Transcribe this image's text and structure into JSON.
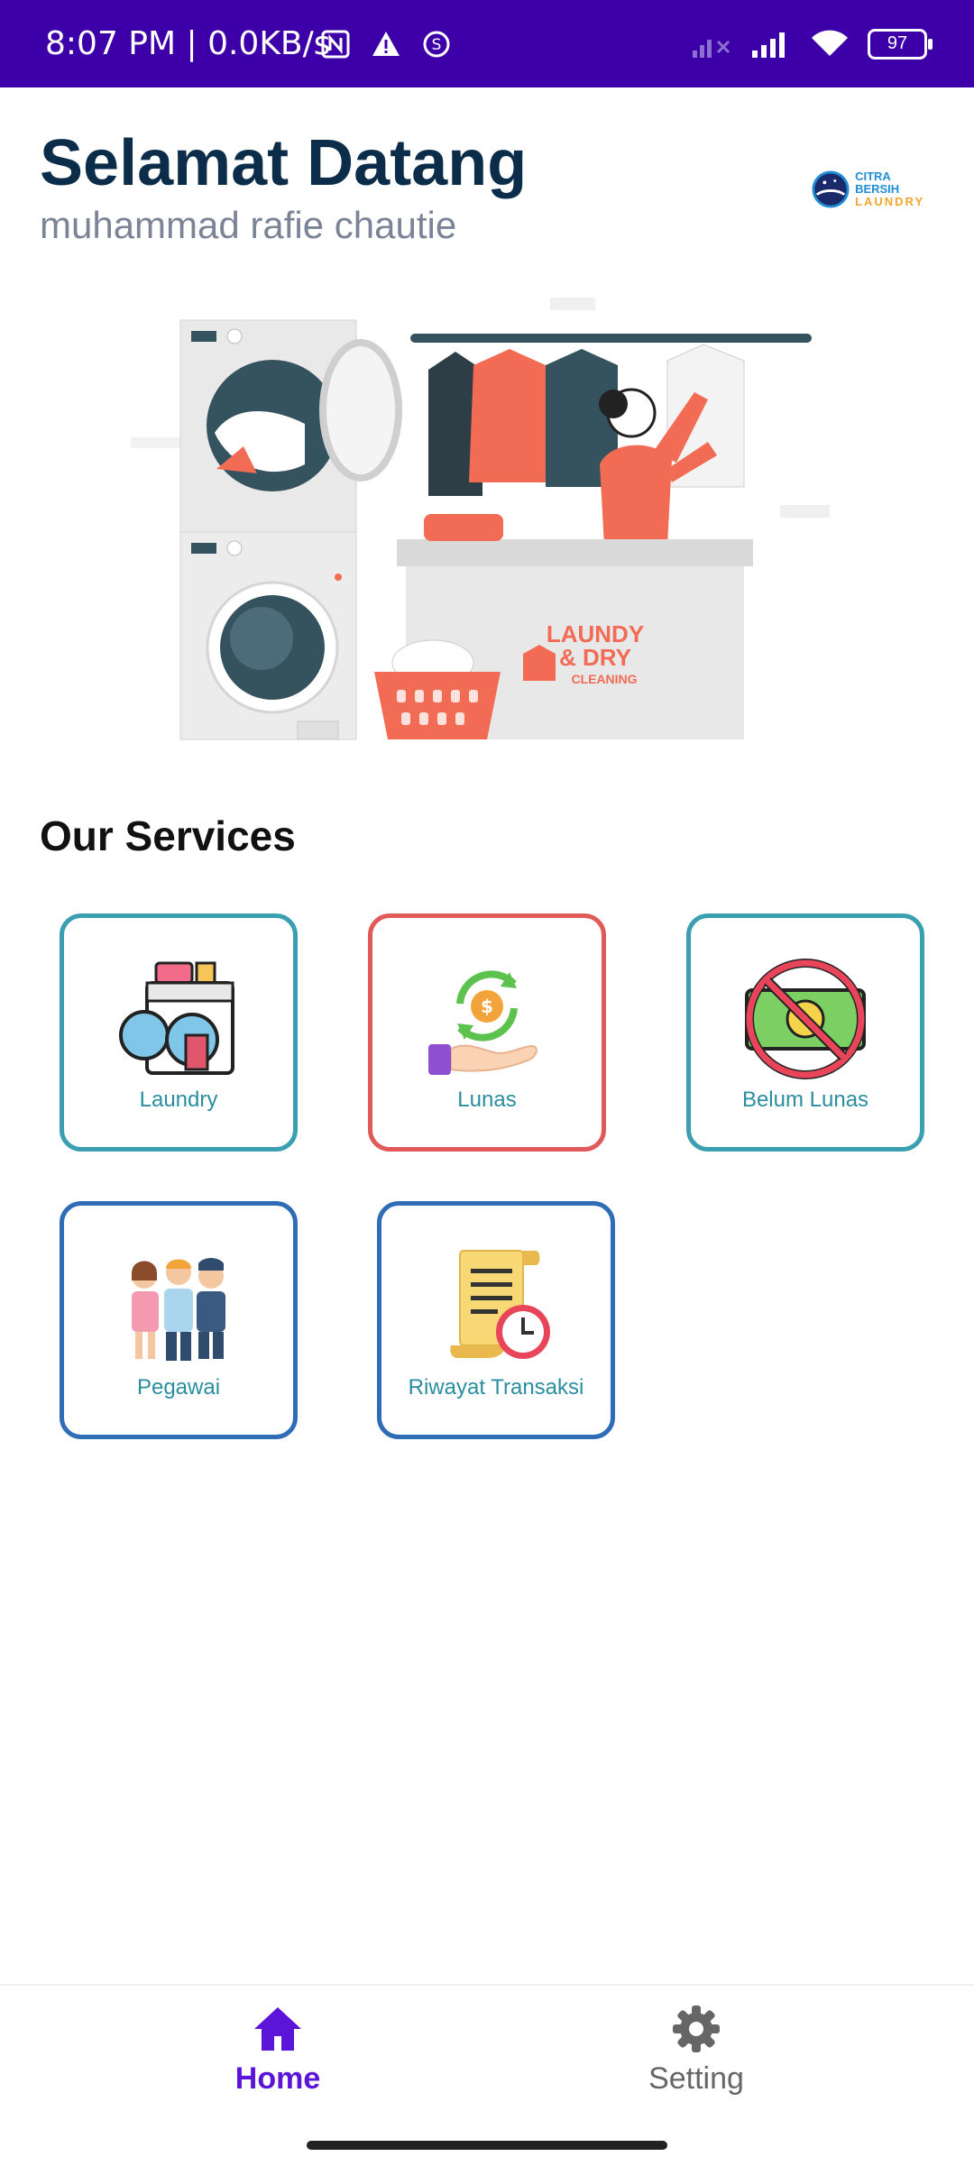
{
  "status_bar": {
    "time_speed": "8:07 PM | 0.0KB/s",
    "battery": "97",
    "icons": [
      "nfc-icon",
      "warning-icon",
      "sync-icon",
      "signal-off-icon",
      "signal-icon",
      "wifi-icon",
      "battery-icon"
    ]
  },
  "header": {
    "title": "Selamat Datang",
    "user_name": "muhammad rafie chautie",
    "logo_line1": "CITRA BERSIH",
    "logo_line2": "LAUNDRY"
  },
  "hero": {
    "sign_line1": "LAUNDY",
    "sign_line2": "& DRY",
    "sign_line3": "CLEANING"
  },
  "services": {
    "title": "Our Services",
    "items": [
      {
        "label": "Laundry",
        "icon": "washing-machine-icon"
      },
      {
        "label": "Lunas",
        "icon": "money-hand-icon"
      },
      {
        "label": "Belum Lunas",
        "icon": "no-money-icon"
      },
      {
        "label": "Pegawai",
        "icon": "employees-icon"
      },
      {
        "label": "Riwayat Transaksi",
        "icon": "history-icon"
      }
    ]
  },
  "nav": {
    "home_label": "Home",
    "setting_label": "Setting"
  },
  "colors": {
    "status_bar": "#3d00a8",
    "title": "#0c2d4a",
    "accent": "#5b14d8",
    "teal": "#3a9fb0",
    "red": "#e05a5a",
    "blue": "#2f6cb6"
  }
}
